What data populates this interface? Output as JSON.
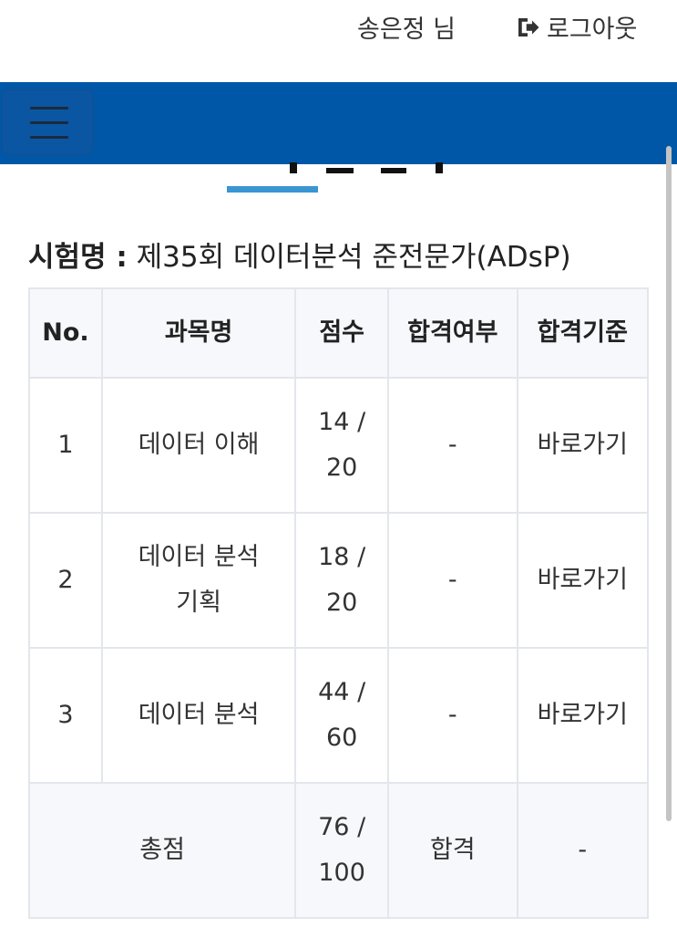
{
  "header": {
    "user_name": "송은정 님",
    "logout_label": "로그아웃",
    "logout_icon": "sign-out-icon"
  },
  "navbar": {
    "menu_icon": "hamburger-menu-icon",
    "color": "#0057a8"
  },
  "exam": {
    "label": "시험명 :",
    "name": "제35회 데이터분석 준전문가(ADsP)"
  },
  "table": {
    "headers": {
      "no": "No.",
      "subject": "과목명",
      "score": "점수",
      "pass": "합격여부",
      "criteria": "합격기준"
    },
    "rows": [
      {
        "no": "1",
        "subject": "데이터 이해",
        "score": "14 / 20",
        "pass": "-",
        "criteria": "바로가기"
      },
      {
        "no": "2",
        "subject": "데이터 분석 기획",
        "score": "18 / 20",
        "pass": "-",
        "criteria": "바로가기"
      },
      {
        "no": "3",
        "subject": "데이터 분석",
        "score": "44 / 60",
        "pass": "-",
        "criteria": "바로가기"
      }
    ],
    "total": {
      "label": "총점",
      "score": "76 / 100",
      "pass": "합격",
      "criteria": "-"
    }
  }
}
